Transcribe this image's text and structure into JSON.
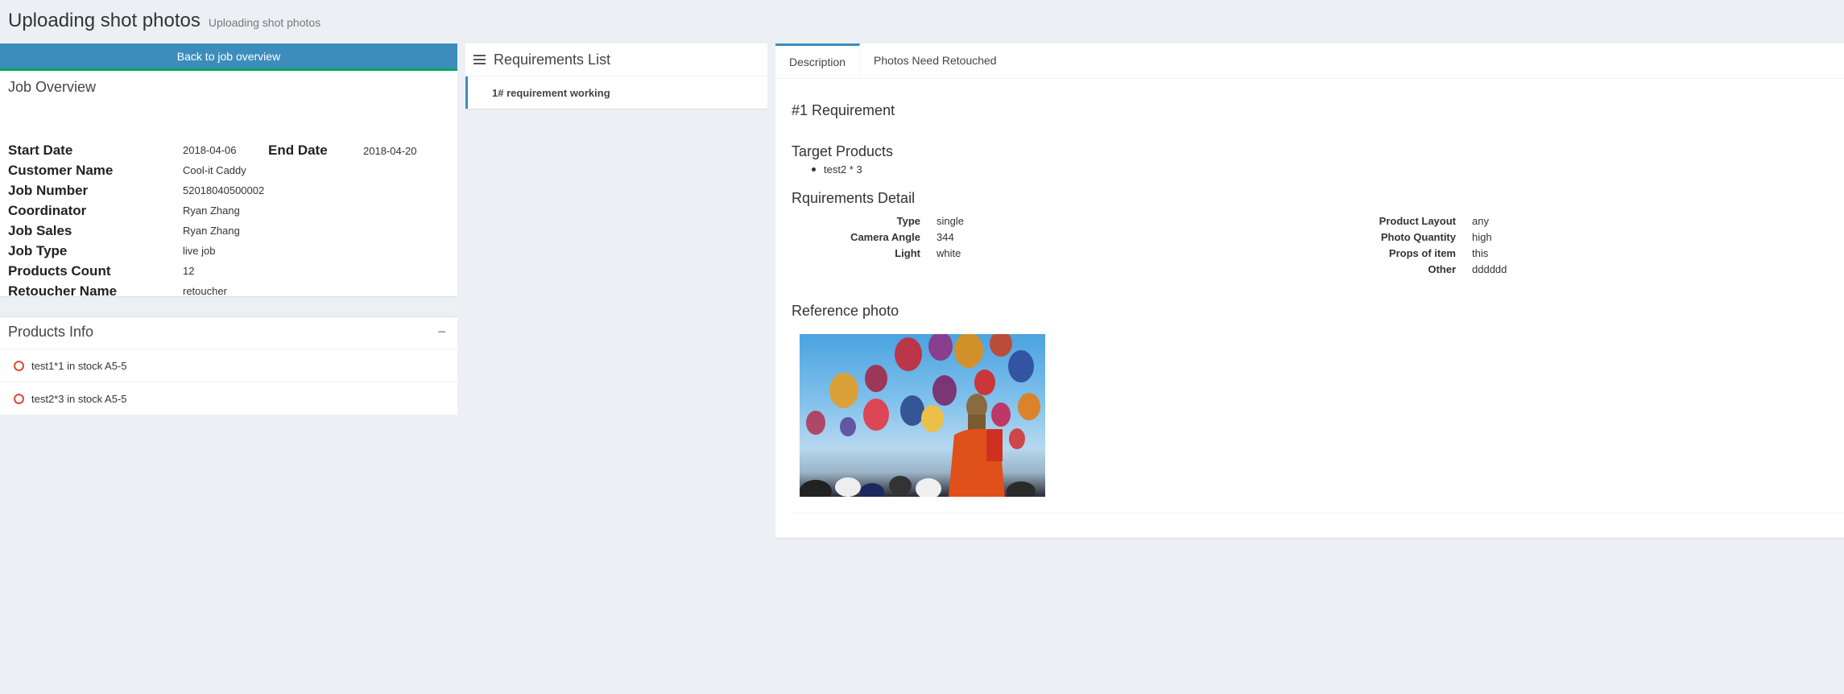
{
  "header": {
    "title": "Uploading shot photos",
    "subtitle": "Uploading shot photos"
  },
  "left": {
    "back_button": "Back to job overview",
    "overview": {
      "title": "Job Overview",
      "start_date_label": "Start Date",
      "start_date": "2018-04-06",
      "end_date_label": "End Date",
      "end_date": "2018-04-20",
      "customer_name_label": "Customer Name",
      "customer_name": "Cool-it Caddy",
      "job_number_label": "Job Number",
      "job_number": "52018040500002",
      "coordinator_label": "Coordinator",
      "coordinator": "Ryan Zhang",
      "job_sales_label": "Job Sales",
      "job_sales": "Ryan Zhang",
      "job_type_label": "Job Type",
      "job_type": "live job",
      "products_count_label": "Products Count",
      "products_count": "12",
      "retoucher_name_label": "Retoucher Name",
      "retoucher_name": "retoucher"
    },
    "products": {
      "title": "Products Info",
      "collapse_symbol": "−",
      "items": [
        "test1*1 in stock A5-5",
        "test2*3 in stock A5-5"
      ]
    }
  },
  "middle": {
    "title": "Requirements List",
    "item": "1# requirement working"
  },
  "right": {
    "tabs": [
      "Description",
      "Photos Need Retouched"
    ],
    "req_heading": "#1 Requirement",
    "target_products_heading": "Target Products",
    "target_products": [
      "test2 * 3"
    ],
    "detail_heading": "Rquirements Detail",
    "detail_left": [
      {
        "label": "Type",
        "value": "single"
      },
      {
        "label": "Camera Angle",
        "value": "344"
      },
      {
        "label": "Light",
        "value": "white"
      }
    ],
    "detail_right": [
      {
        "label": "Product Layout",
        "value": "any"
      },
      {
        "label": "Photo Quantity",
        "value": "high"
      },
      {
        "label": "Props of item",
        "value": "this"
      },
      {
        "label": "Other",
        "value": "dddddd"
      }
    ],
    "reference_heading": "Reference photo"
  },
  "colors": {
    "primary": "#3c8dbc",
    "success": "#00a65a",
    "danger": "#dd4b39",
    "background": "#ecf0f5"
  }
}
